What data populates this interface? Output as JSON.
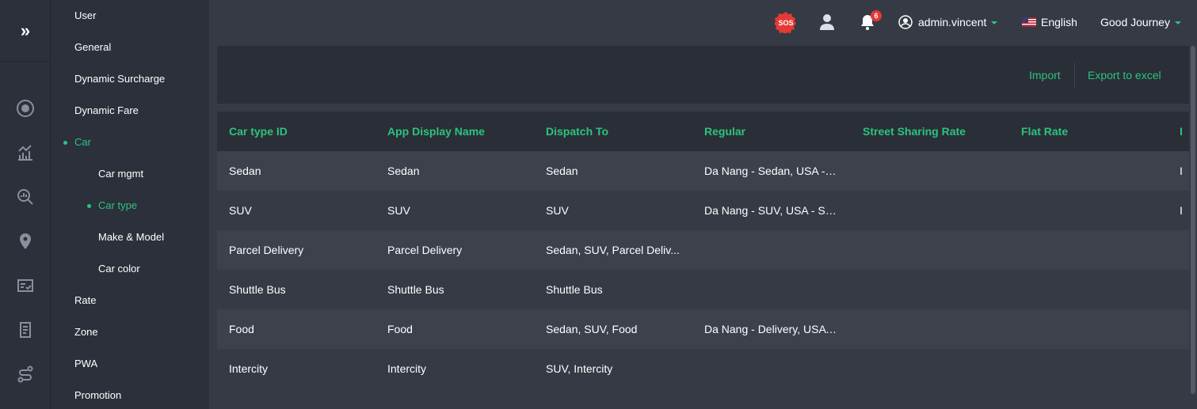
{
  "rail": {
    "expand_glyph": "»",
    "icons": [
      "add-circle-icon",
      "analytics-icon",
      "search-report-icon",
      "location-pin-icon",
      "checklist-icon",
      "document-icon",
      "route-icon"
    ]
  },
  "menu": {
    "items": [
      {
        "label": "User",
        "level": 1,
        "active": false
      },
      {
        "label": "General",
        "level": 1,
        "active": false
      },
      {
        "label": "Dynamic Surcharge",
        "level": 1,
        "active": false
      },
      {
        "label": "Dynamic Fare",
        "level": 1,
        "active": false
      },
      {
        "label": "Car",
        "level": 1,
        "active": true
      },
      {
        "label": "Car mgmt",
        "level": 2,
        "active": false
      },
      {
        "label": "Car type",
        "level": 2,
        "active": true
      },
      {
        "label": "Make & Model",
        "level": 2,
        "active": false
      },
      {
        "label": "Car color",
        "level": 2,
        "active": false
      },
      {
        "label": "Rate",
        "level": 1,
        "active": false
      },
      {
        "label": "Zone",
        "level": 1,
        "active": false
      },
      {
        "label": "PWA",
        "level": 1,
        "active": false
      },
      {
        "label": "Promotion",
        "level": 1,
        "active": false
      }
    ]
  },
  "header": {
    "sos_label": "SOS",
    "notification_count": "6",
    "user_name": "admin.vincent",
    "language": "English",
    "company": "Good Journey"
  },
  "toolbar": {
    "import_label": "Import",
    "export_label": "Export to excel"
  },
  "table": {
    "columns": [
      "Car type ID",
      "App Display Name",
      "Dispatch To",
      "Regular",
      "Street Sharing Rate",
      "Flat Rate",
      "I"
    ],
    "rows": [
      [
        "Sedan",
        "Sedan",
        "Sedan",
        "Da Nang - Sedan, USA - S...",
        "",
        "",
        "I"
      ],
      [
        "SUV",
        "SUV",
        "SUV",
        "Da Nang - SUV, USA - SUV",
        "",
        "",
        "I"
      ],
      [
        "Parcel Delivery",
        "Parcel Delivery",
        "Sedan, SUV, Parcel Deliv...",
        "",
        "",
        "",
        ""
      ],
      [
        "Shuttle Bus",
        "Shuttle Bus",
        "Shuttle Bus",
        "",
        "",
        "",
        ""
      ],
      [
        "Food",
        "Food",
        "Sedan, SUV, Food",
        "Da Nang - Delivery, USA -...",
        "",
        "",
        ""
      ],
      [
        "Intercity",
        "Intercity",
        "SUV, Intercity",
        "",
        "",
        "",
        ""
      ]
    ]
  },
  "colors": {
    "accent": "#2bc47d",
    "sidebar_bg": "#2c303a",
    "content_bg": "#363a45",
    "badge": "#e53935",
    "sos": "#e53935"
  }
}
